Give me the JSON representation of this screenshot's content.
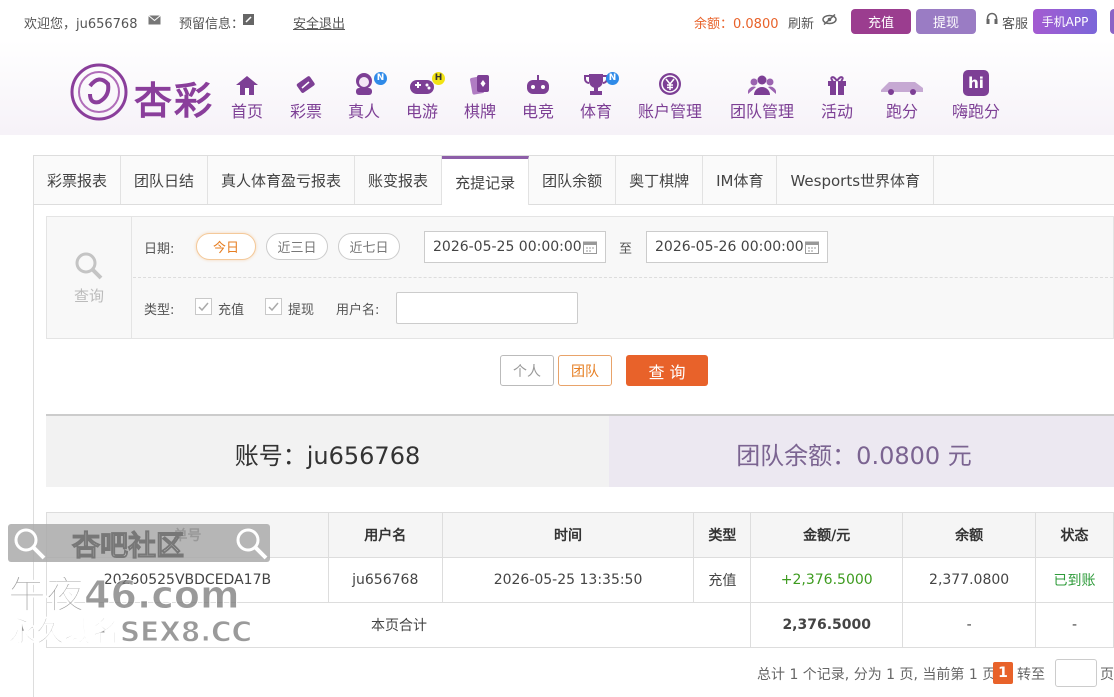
{
  "topbar": {
    "welcome": "欢迎您，ju656768",
    "message_label": "预留信息：",
    "logout": "安全退出",
    "balance": "余额：0.0800",
    "refresh": "刷新",
    "recharge": "充值",
    "withdraw": "提现",
    "service": "客服",
    "app": "手机APP"
  },
  "logo": {
    "text": "杏彩"
  },
  "nav": [
    {
      "label": "首页",
      "icon": "home-icon"
    },
    {
      "label": "彩票",
      "icon": "lottery-icon"
    },
    {
      "label": "真人",
      "icon": "live-dealer-icon",
      "badge": "N"
    },
    {
      "label": "电游",
      "icon": "gamepad-icon",
      "badge": "H"
    },
    {
      "label": "棋牌",
      "icon": "cards-icon"
    },
    {
      "label": "电竞",
      "icon": "esports-icon"
    },
    {
      "label": "体育",
      "icon": "trophy-icon",
      "badge": "N"
    },
    {
      "label": "账户管理",
      "icon": "yen-icon"
    },
    {
      "label": "团队管理",
      "icon": "team-icon"
    },
    {
      "label": "活动",
      "icon": "gift-icon"
    },
    {
      "label": "跑分",
      "icon": "car-icon"
    },
    {
      "label": "嗨跑分",
      "icon": "hi-icon",
      "icon_text": "hi"
    }
  ],
  "tabs": [
    "彩票报表",
    "团队日结",
    "真人体育盈亏报表",
    "账变报表",
    "充提记录",
    "团队余额",
    "奥丁棋牌",
    "IM体育",
    "Wesports世界体育"
  ],
  "active_tab": 4,
  "query": {
    "side_label": "查询",
    "date_label": "日期:",
    "today": "今日",
    "three_days": "近三日",
    "seven_days": "近七日",
    "start": "2026-05-25 00:00:00",
    "to": "至",
    "end": "2026-05-26 00:00:00",
    "type_label": "类型:",
    "type_recharge": "充值",
    "type_withdraw": "提现",
    "user_label": "用户名:",
    "username": ""
  },
  "buttons": {
    "personal": "个人",
    "team": "团队",
    "search": "查 询"
  },
  "info": {
    "account": "账号：ju656768",
    "team_balance": "团队余额：0.0800 元"
  },
  "table": {
    "headers": [
      "单号",
      "用户名",
      "时间",
      "类型",
      "金额/元",
      "余额",
      "状态"
    ],
    "rows": [
      [
        "20260525VBDCEDA17B",
        "ju656768",
        "2026-05-25 13:35:50",
        "充值",
        "+2,376.5000",
        "2,377.0800",
        "已到账"
      ]
    ],
    "total_label": "本页合计",
    "total_amount": "2,376.5000",
    "total_dash1": "-",
    "total_dash2": "-"
  },
  "pager": {
    "summary": "总计 1 个记录, 分为 1 页, 当前第 1 页",
    "current": "1",
    "goto": "转至",
    "page": "页"
  },
  "watermark": {
    "line1": "杏吧社区",
    "line2": "午夜46.com",
    "line3": "永久域名SEX8.CC"
  },
  "colors": {
    "purple": "#7d3f95",
    "orange": "#e67e22",
    "green": "#2e9b3a",
    "search": "#e8622a"
  }
}
